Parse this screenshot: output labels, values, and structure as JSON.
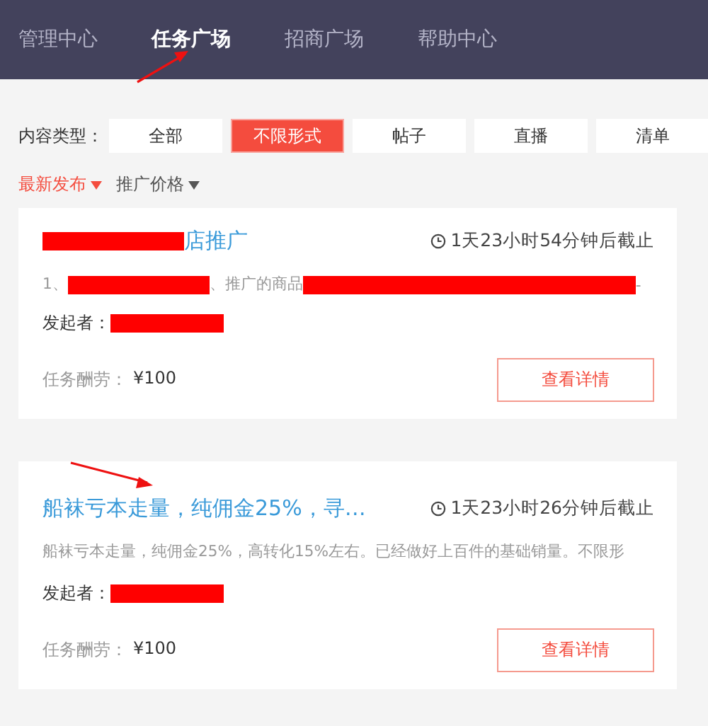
{
  "nav": [
    {
      "label": "管理中心",
      "selected": false
    },
    {
      "label": "任务广场",
      "selected": true
    },
    {
      "label": "招商广场",
      "selected": false
    },
    {
      "label": "帮助中心",
      "selected": false
    }
  ],
  "filter": {
    "label": "内容类型：",
    "options": [
      {
        "label": "全部",
        "selected": false
      },
      {
        "label": "不限形式",
        "selected": true
      },
      {
        "label": "帖子",
        "selected": false
      },
      {
        "label": "直播",
        "selected": false
      },
      {
        "label": "清单",
        "selected": false
      }
    ]
  },
  "sort": [
    {
      "label": "最新发布",
      "selected": true
    },
    {
      "label": "推广价格",
      "selected": false
    }
  ],
  "tasks": [
    {
      "title": [
        {
          "kind": "redacted"
        },
        {
          "kind": "text",
          "text": "店推广"
        }
      ],
      "deadline": "1天23小时54分钟后截止",
      "description": [
        {
          "kind": "text",
          "text": "1、"
        },
        {
          "kind": "redacted"
        },
        {
          "kind": "text",
          "text": "、推广的商品"
        },
        {
          "kind": "longredacted"
        },
        {
          "kind": "text",
          "text": "-"
        }
      ],
      "publisher_label": "发起者：",
      "reward_label": "任务酬劳：",
      "reward": "¥100",
      "button": "查看详情"
    },
    {
      "title": [
        {
          "kind": "text",
          "text": "船袜亏本走量，纯佣金25%，寻…"
        }
      ],
      "deadline": "1天23小时26分钟后截止",
      "description": [
        {
          "kind": "text",
          "text": "船袜亏本走量，纯佣金25%，高转化15%左右。已经做好上百件的基础销量。不限形"
        }
      ],
      "publisher_label": "发起者：",
      "reward_label": "任务酬劳：",
      "reward": "¥100",
      "button": "查看详情"
    }
  ],
  "annotations": [
    {
      "kind": "arrow"
    },
    {
      "kind": "arrow"
    }
  ]
}
